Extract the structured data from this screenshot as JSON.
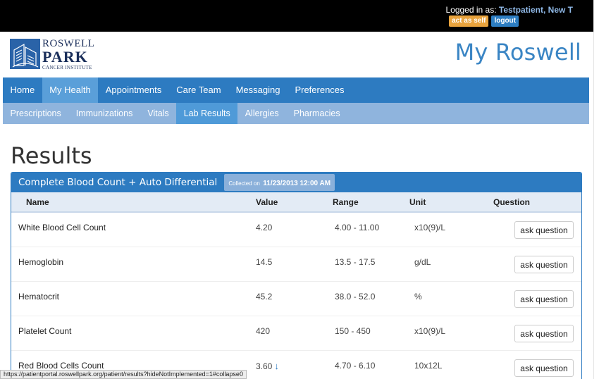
{
  "top": {
    "logged_in_label": "Logged in as:",
    "username": "Testpatient, New T",
    "act_as_self": "act as self",
    "logout": "logout"
  },
  "header": {
    "logo_line1": "ROSWELL",
    "logo_line2": "PARK",
    "logo_line3": "CANCER INSTITUTE",
    "brand_title": "My Roswell"
  },
  "main_nav": [
    {
      "label": "Home",
      "active": false
    },
    {
      "label": "My Health",
      "active": true
    },
    {
      "label": "Appointments",
      "active": false
    },
    {
      "label": "Care Team",
      "active": false
    },
    {
      "label": "Messaging",
      "active": false
    },
    {
      "label": "Preferences",
      "active": false
    }
  ],
  "sub_nav": [
    {
      "label": "Prescriptions",
      "active": false
    },
    {
      "label": "Immunizations",
      "active": false
    },
    {
      "label": "Vitals",
      "active": false
    },
    {
      "label": "Lab Results",
      "active": true
    },
    {
      "label": "Allergies",
      "active": false
    },
    {
      "label": "Pharmacies",
      "active": false
    }
  ],
  "page": {
    "title": "Results"
  },
  "panel": {
    "title": "Complete Blood Count + Auto Differential",
    "collected_label": "Collected on",
    "collected_date": "11/23/2013 12:00 AM",
    "columns": {
      "name": "Name",
      "value": "Value",
      "range": "Range",
      "unit": "Unit",
      "question": "Question"
    },
    "rows": [
      {
        "name": "White Blood Cell Count",
        "value": "4.20",
        "range": "4.00 - 11.00",
        "unit": "x10(9)/L",
        "ask": "ask question",
        "low": false
      },
      {
        "name": "Hemoglobin",
        "value": "14.5",
        "range": "13.5 - 17.5",
        "unit": "g/dL",
        "ask": "ask question",
        "low": false
      },
      {
        "name": "Hematocrit",
        "value": "45.2",
        "range": "38.0 - 52.0",
        "unit": "%",
        "ask": "ask question",
        "low": false
      },
      {
        "name": "Platelet Count",
        "value": "420",
        "range": "150 - 450",
        "unit": "x10(9)/L",
        "ask": "ask question",
        "low": false
      },
      {
        "name": "Red Blood Cells Count",
        "value": "3.60",
        "range": "4.70 - 6.10",
        "unit": "10x12L",
        "ask": "ask question",
        "low": true
      }
    ]
  },
  "status_bar": {
    "url": "https://patientportal.roswellpark.org/patient/results?hideNotImplemented=1#collapse0"
  },
  "colors": {
    "nav_primary": "#2d7bc1",
    "nav_active": "#5a9fd9",
    "subnav": "#8fb4dd",
    "subnav_active": "#4f9ad8",
    "act_as_self": "#e8a33d",
    "logout": "#2d7ec2",
    "brand_title": "#3a85c4"
  },
  "icons": {
    "low_indicator": "down-arrow-icon"
  }
}
